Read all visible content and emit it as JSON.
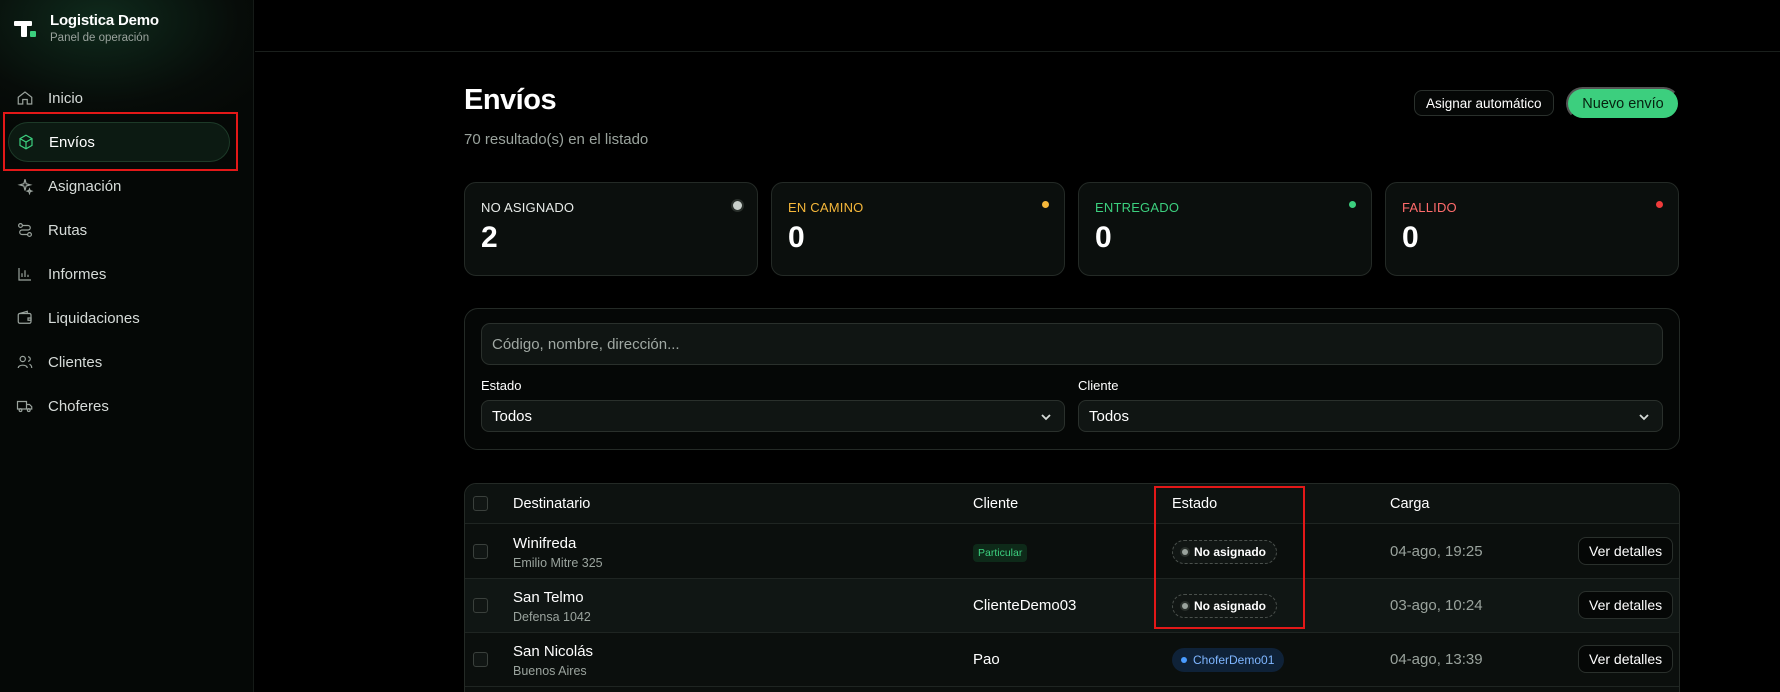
{
  "brand": {
    "title": "Logistica Demo",
    "subtitle": "Panel de operación"
  },
  "sidebar": {
    "items": [
      {
        "label": "Inicio",
        "icon": "home-icon"
      },
      {
        "label": "Envíos",
        "icon": "box-icon",
        "active": true
      },
      {
        "label": "Asignación",
        "icon": "sparkles-icon"
      },
      {
        "label": "Rutas",
        "icon": "route-icon"
      },
      {
        "label": "Informes",
        "icon": "bar-chart-icon"
      },
      {
        "label": "Liquidaciones",
        "icon": "wallet-icon"
      },
      {
        "label": "Clientes",
        "icon": "users-icon"
      },
      {
        "label": "Choferes",
        "icon": "truck-icon"
      }
    ]
  },
  "header": {
    "title": "Envíos",
    "subtitle": "70 resultado(s) en el listado",
    "auto_assign_label": "Asignar automático",
    "new_label": "Nuevo envío"
  },
  "stats": [
    {
      "label": "NO ASIGNADO",
      "value": "2",
      "color": "#e8ece9",
      "dot": "#c9cfcb"
    },
    {
      "label": "EN CAMINO",
      "value": "0",
      "color": "#f5b73a",
      "dot": "#f5b73a"
    },
    {
      "label": "ENTREGADO",
      "value": "0",
      "color": "#3ccf7e",
      "dot": "#3ccf7e"
    },
    {
      "label": "FALLIDO",
      "value": "0",
      "color": "#ff6b6b",
      "dot": "#ef3b3b"
    }
  ],
  "filters": {
    "search_placeholder": "Código, nombre, dirección...",
    "estado_label": "Estado",
    "estado_value": "Todos",
    "cliente_label": "Cliente",
    "cliente_value": "Todos"
  },
  "table": {
    "headers": {
      "destinatario": "Destinatario",
      "cliente": "Cliente",
      "estado": "Estado",
      "carga": "Carga"
    },
    "rows": [
      {
        "name": "Winifreda",
        "address": "Emilio Mitre 325",
        "client": "Particular",
        "status": "No asignado",
        "load": "04-ago, 19:25",
        "action": "Ver detalles"
      },
      {
        "name": "San Telmo",
        "address": "Defensa 1042",
        "client": "ClienteDemo03",
        "status": "No asignado",
        "load": "03-ago, 10:24",
        "action": "Ver detalles"
      },
      {
        "name": "San Nicolás",
        "address": "Buenos Aires",
        "client": "Pao",
        "status": "ChoferDemo01",
        "load": "04-ago, 13:39",
        "action": "Ver detalles"
      }
    ]
  }
}
